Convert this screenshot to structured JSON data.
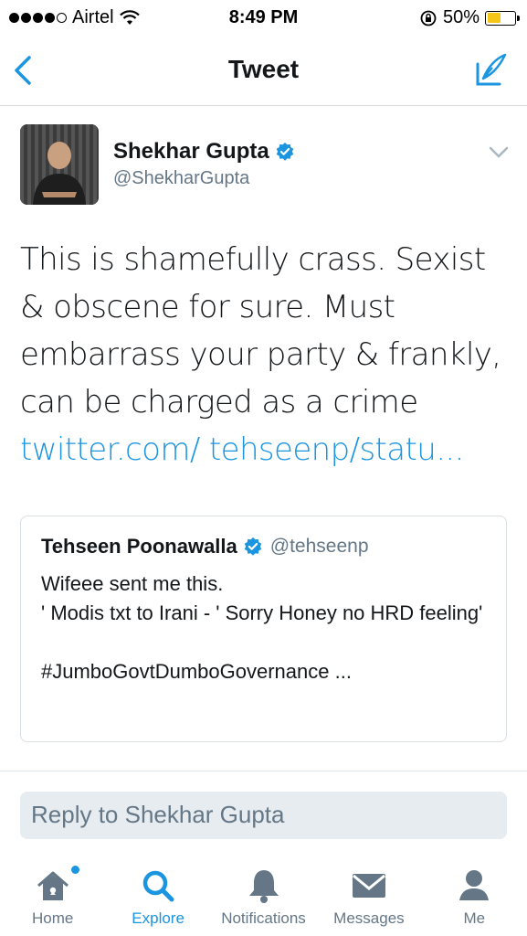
{
  "status_bar": {
    "carrier": "Airtel",
    "time": "8:49 PM",
    "battery_percent": "50%",
    "battery_level": 0.5,
    "battery_color": "#f5c518"
  },
  "nav": {
    "title": "Tweet",
    "back_icon": "chevron-left-icon",
    "compose_icon": "compose-quill-icon",
    "accent": "#1b95e0"
  },
  "tweet": {
    "author_name": "Shekhar Gupta",
    "author_handle": "@ShekharGupta",
    "verified": true,
    "text": "This is shamefully crass. Sexist & obscene for sure. Must embarrass your party & frankly, can be charged as a crime ",
    "link_text": "twitter.com/ tehseenp/statu..."
  },
  "quoted_tweet": {
    "author_name": "Tehseen Poonawalla",
    "author_handle": "@tehseenp",
    "verified": true,
    "text": "Wifeee sent me this.\n' Modis txt to Irani - ' Sorry Honey no HRD feeling'\n\n#JumboGovtDumboGovernance ..."
  },
  "reply": {
    "placeholder": "Reply to Shekhar Gupta"
  },
  "tabs": [
    {
      "label": "Home",
      "icon": "home-icon",
      "active": false
    },
    {
      "label": "Explore",
      "icon": "search-icon",
      "active": true
    },
    {
      "label": "Notifications",
      "icon": "bell-icon",
      "active": false
    },
    {
      "label": "Messages",
      "icon": "envelope-icon",
      "active": false
    },
    {
      "label": "Me",
      "icon": "person-icon",
      "active": false
    }
  ]
}
